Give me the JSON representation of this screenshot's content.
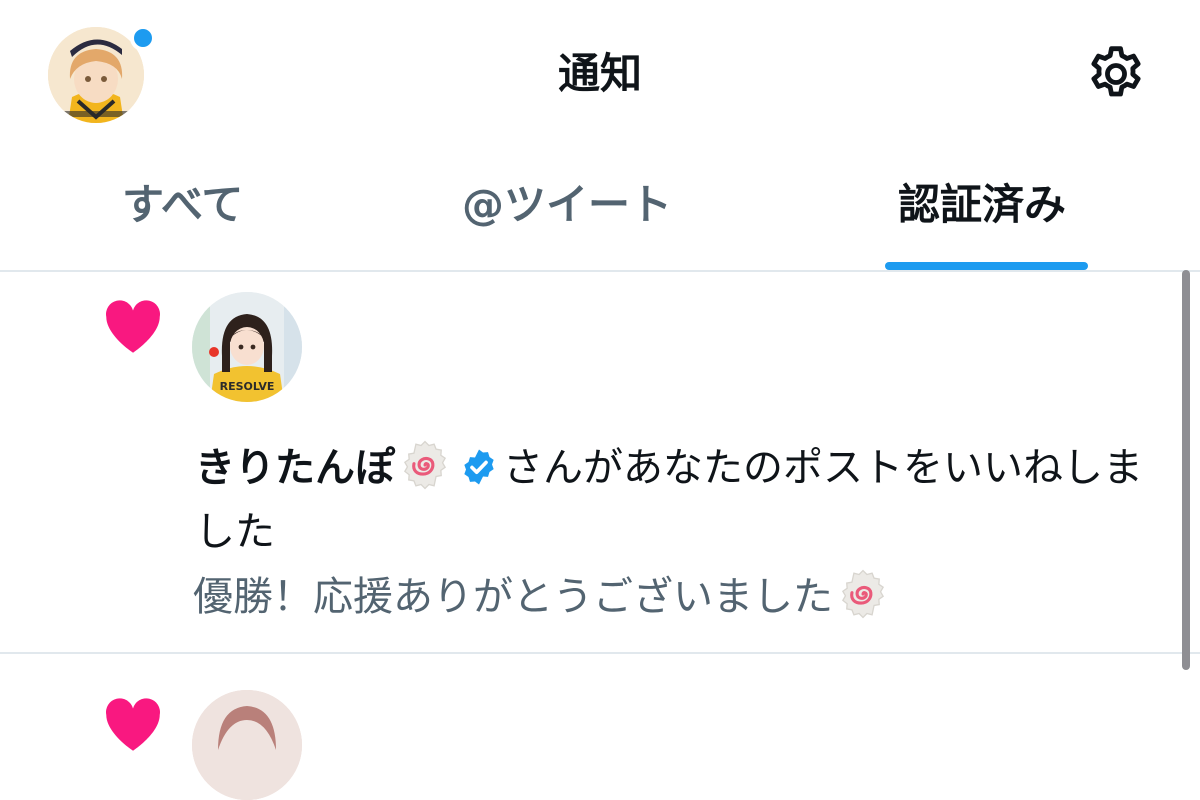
{
  "header": {
    "title": "通知",
    "settings_icon": "gear-icon",
    "avatar_icon": "user-avatar"
  },
  "tabs": [
    {
      "label": "すべて",
      "active": false
    },
    {
      "label": "@ツイート",
      "active": false
    },
    {
      "label": "認証済み",
      "active": true
    }
  ],
  "notifications": [
    {
      "type": "like",
      "icon": "heart-icon",
      "user_name": "きりたんぽ",
      "name_emoji": "narutomaki-emoji",
      "verified_icon": "verified-badge-icon",
      "action_text": "さんがあなたのポストをいいねしました",
      "quote": "優勝！応援ありがとうございました",
      "quote_emoji": "narutomaki-emoji"
    },
    {
      "type": "like",
      "icon": "heart-icon"
    }
  ],
  "colors": {
    "accent": "#1d9bf0",
    "heart": "#f91880",
    "text_primary": "#0f1419",
    "text_secondary": "#536471",
    "divider": "#e1e8ed"
  }
}
